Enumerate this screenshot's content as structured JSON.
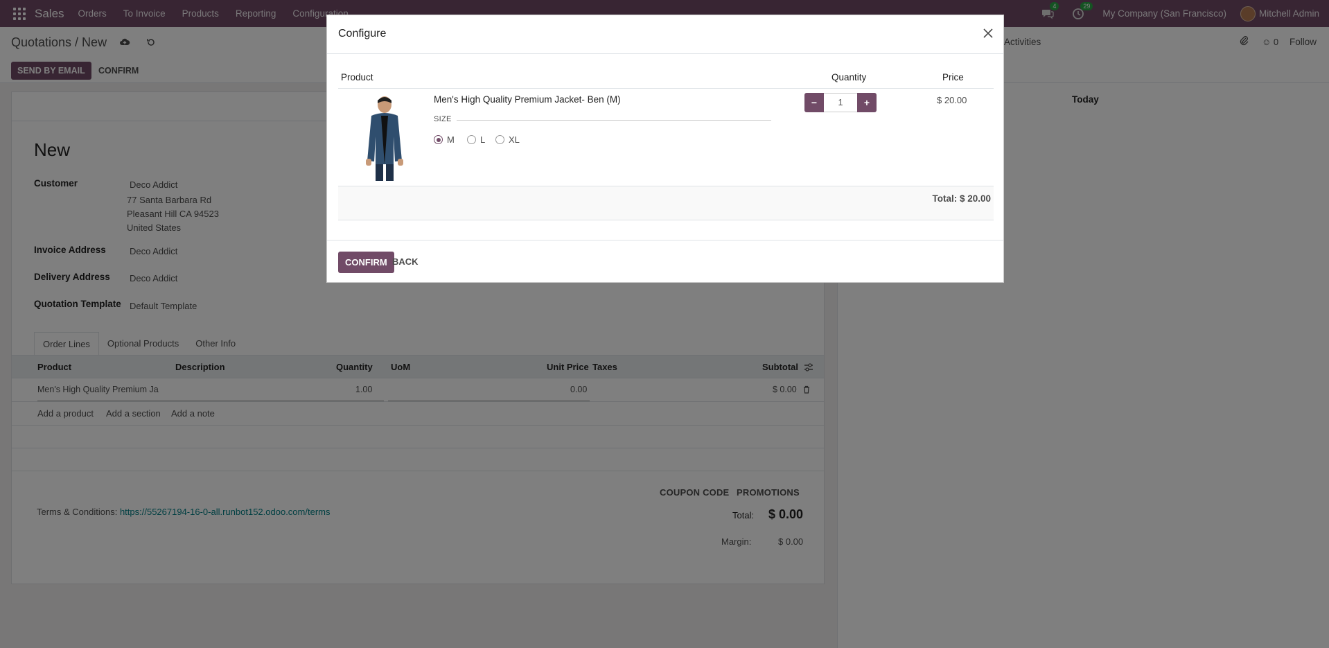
{
  "navbar": {
    "brand": "Sales",
    "menu": [
      "Orders",
      "To Invoice",
      "Products",
      "Reporting",
      "Configuration"
    ],
    "messages_badge": "4",
    "activities_badge": "29",
    "company": "My Company (San Francisco)",
    "user": "Mitchell Admin"
  },
  "control": {
    "breadcrumb": "Quotations / New",
    "send_by_email": "SEND BY EMAIL",
    "confirm": "CONFIRM",
    "activities": "Activities",
    "followers_count": "0",
    "follow": "Follow"
  },
  "form": {
    "name": "New",
    "customer_label": "Customer",
    "customer_name": "Deco Addict",
    "customer_address": [
      "77 Santa Barbara Rd",
      "Pleasant Hill CA 94523",
      "United States"
    ],
    "invoice_label": "Invoice Address",
    "invoice_value": "Deco Addict",
    "delivery_label": "Delivery Address",
    "delivery_value": "Deco Addict",
    "template_label": "Quotation Template",
    "template_value": "Default Template",
    "tabs": [
      "Order Lines",
      "Optional Products",
      "Other Info"
    ],
    "columns": [
      "Product",
      "Description",
      "Quantity",
      "UoM",
      "Unit Price",
      "Taxes",
      "Subtotal"
    ],
    "line": {
      "product": "Men's High Quality Premium Ja",
      "quantity": "1.00",
      "unit_price": "0.00",
      "subtotal": "$ 0.00"
    },
    "add_product": "Add a product",
    "add_section": "Add a section",
    "add_note": "Add a note",
    "coupon_code": "COUPON CODE",
    "promotions": "PROMOTIONS",
    "terms_label": "Terms & Conditions:",
    "terms_link": "https://55267194-16-0-all.runbot152.odoo.com/terms",
    "total_label": "Total:",
    "total_value": "$ 0.00",
    "margin_label": "Margin:",
    "margin_value": "$ 0.00"
  },
  "chatter": {
    "today": "Today"
  },
  "modal": {
    "title": "Configure",
    "col_product": "Product",
    "col_quantity": "Quantity",
    "col_price": "Price",
    "product_name": "Men's High Quality Premium Jacket- Ben (M)",
    "attribute_label": "SIZE",
    "options": [
      "M",
      "L",
      "XL"
    ],
    "selected_option": "M",
    "quantity": "1",
    "price": "$ 20.00",
    "total": "Total: $ 20.00",
    "confirm": "CONFIRM",
    "back": "BACK"
  },
  "colors": {
    "brand": "#714b67",
    "link": "#017e84",
    "badge": "#28a745"
  }
}
